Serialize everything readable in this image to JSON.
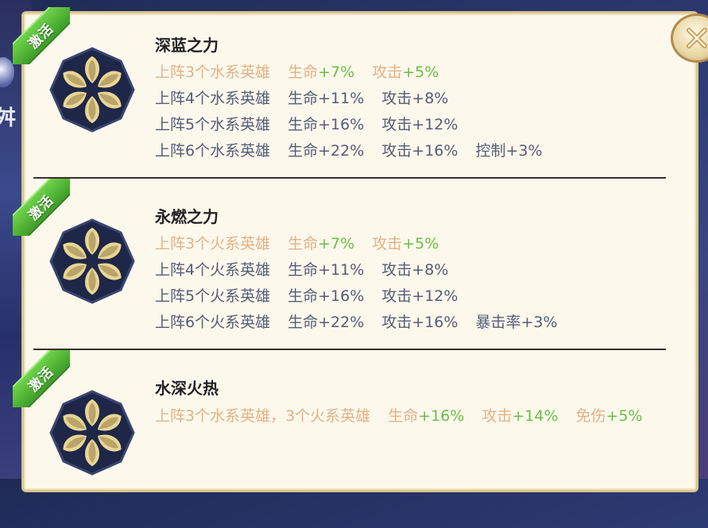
{
  "close_icon": "close-x-icon",
  "badge_label": "激活",
  "bonuses": [
    {
      "title": "深蓝之力",
      "tiers": [
        {
          "req": "上阵3个水系英雄",
          "stats": [
            [
              "生命",
              "+7%"
            ],
            [
              "攻击",
              "+5%"
            ]
          ],
          "active": true
        },
        {
          "req": "上阵4个水系英雄",
          "stats": [
            [
              "生命",
              "+11%"
            ],
            [
              "攻击",
              "+8%"
            ]
          ],
          "active": false
        },
        {
          "req": "上阵5个水系英雄",
          "stats": [
            [
              "生命",
              "+16%"
            ],
            [
              "攻击",
              "+12%"
            ]
          ],
          "active": false
        },
        {
          "req": "上阵6个水系英雄",
          "stats": [
            [
              "生命",
              "+22%"
            ],
            [
              "攻击",
              "+16%"
            ],
            [
              "控制",
              "+3%"
            ]
          ],
          "active": false
        }
      ]
    },
    {
      "title": "永燃之力",
      "tiers": [
        {
          "req": "上阵3个火系英雄",
          "stats": [
            [
              "生命",
              "+7%"
            ],
            [
              "攻击",
              "+5%"
            ]
          ],
          "active": true
        },
        {
          "req": "上阵4个火系英雄",
          "stats": [
            [
              "生命",
              "+11%"
            ],
            [
              "攻击",
              "+8%"
            ]
          ],
          "active": false
        },
        {
          "req": "上阵5个火系英雄",
          "stats": [
            [
              "生命",
              "+16%"
            ],
            [
              "攻击",
              "+12%"
            ]
          ],
          "active": false
        },
        {
          "req": "上阵6个火系英雄",
          "stats": [
            [
              "生命",
              "+22%"
            ],
            [
              "攻击",
              "+16%"
            ],
            [
              "暴击率",
              "+3%"
            ]
          ],
          "active": false
        }
      ]
    },
    {
      "title": "水深火热",
      "tiers": [
        {
          "req": "上阵3个水系英雄，3个火系英雄",
          "stats": [
            [
              "生命",
              "+16%"
            ],
            [
              "攻击",
              "+14%"
            ],
            [
              "免伤",
              "+5%"
            ]
          ],
          "active": true
        }
      ]
    }
  ],
  "colors": {
    "active_text": "#e2b287",
    "active_value": "#6abf45",
    "inactive_text": "#555c77",
    "badge_green": "#4cb032",
    "panel_bg": "#fcf8ec"
  }
}
